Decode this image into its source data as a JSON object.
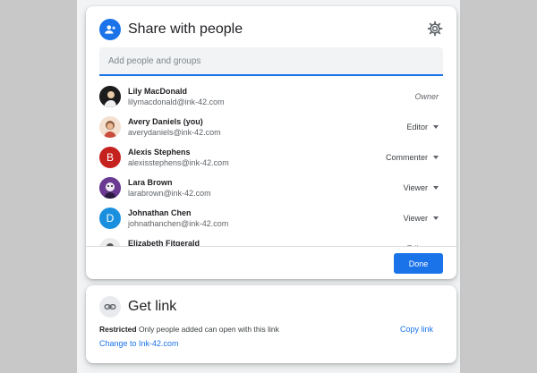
{
  "share": {
    "title": "Share with people",
    "input_placeholder": "Add people and groups",
    "people": [
      {
        "name": "Lily MacDonald",
        "email": "lilymacdonald@ink-42.com",
        "role": "Owner",
        "avatar": "photo"
      },
      {
        "name": "Avery Daniels (you)",
        "email": "averydaniels@ink-42.com",
        "role": "Editor",
        "avatar": "photo"
      },
      {
        "name": "Alexis Stephens",
        "email": "alexisstephens@ink-42.com",
        "role": "Commenter",
        "avatar": "B",
        "avatar_color": "#c5221f"
      },
      {
        "name": "Lara Brown",
        "email": "larabrown@ink-42.com",
        "role": "Viewer",
        "avatar": "photo"
      },
      {
        "name": "Johnathan Chen",
        "email": "johnathanchen@ink-42.com",
        "role": "Viewer",
        "avatar": "D",
        "avatar_color": "#1a8fde"
      },
      {
        "name": "Elizabeth Fitgerald",
        "email": "",
        "role": "Editor",
        "avatar": "photo"
      }
    ],
    "done_label": "Done"
  },
  "link": {
    "title": "Get link",
    "restricted_label": "Restricted",
    "restricted_text": " Only people added can open with this link",
    "change_label": "Change to Ink-42.com",
    "copy_label": "Copy link"
  },
  "colors": {
    "accent": "#1a73e8"
  }
}
